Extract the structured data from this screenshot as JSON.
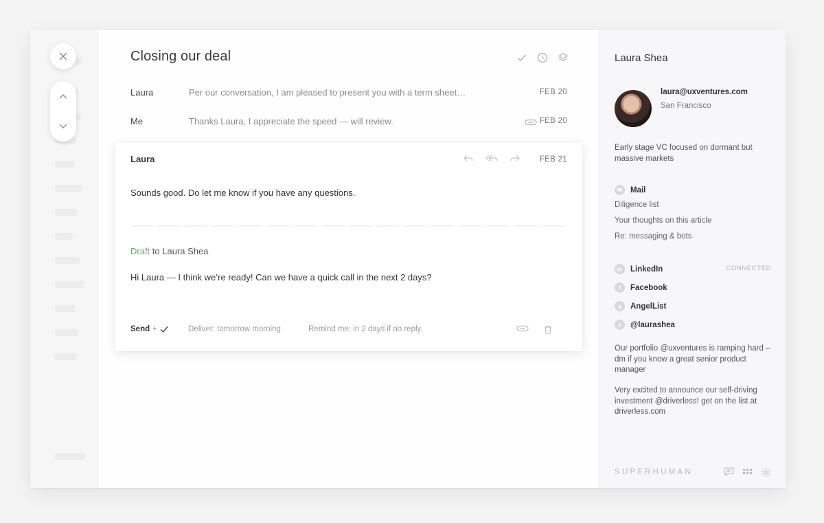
{
  "thread": {
    "subject": "Closing our deal",
    "messages": [
      {
        "from": "Laura",
        "snippet": "Per our conversation, I am pleased to present you with a term sheet…",
        "date": "FEB 20"
      },
      {
        "from": "Me",
        "snippet": "Thanks Laura, I appreciate the speed — will review.",
        "date": "FEB 20"
      }
    ],
    "open_message": {
      "from": "Laura",
      "date": "FEB 21",
      "body": "Sounds good.  Do let me know if you have any questions."
    },
    "draft": {
      "tag": "Draft",
      "to": "to Laura Shea",
      "body": "Hi Laura — I think we’re ready! Can we have a quick call in the next 2 days?",
      "send_label": "Send",
      "send_suffix": "+",
      "deliver": "Deliver: tomorrow morning",
      "remind": "Remind me: in 2 days if no reply"
    }
  },
  "contact": {
    "name": "Laura Shea",
    "email": "laura@uxventures.com",
    "location": "San Francisco",
    "bio": "Early stage VC focused on dormant but massive markets",
    "mail": {
      "heading": "Mail",
      "items": [
        "Diligence list",
        "Your thoughts on this article",
        "Re: messaging & bots"
      ]
    },
    "socials": {
      "linkedin": "LinkedIn",
      "facebook": "Facebook",
      "angellist": "AngelList",
      "twitter": "@laurashea",
      "connected": "CONNECTED"
    },
    "tweets": [
      "Our portfolio @uxventures is ramping hard – dm if you know a great senior product manager",
      "Very excited to announce our self-driving investment @driverless! get on the list at driverless.com"
    ]
  },
  "brand": "SUPERHUMAN",
  "colors": {
    "draft_green": "#6aaa6a",
    "background": "#f4f4f5"
  },
  "icons": [
    "close-icon",
    "chevron-up-icon",
    "chevron-down-icon",
    "check-icon",
    "clock-icon",
    "layers-icon",
    "attachment-icon",
    "reply-icon",
    "reply-all-icon",
    "forward-icon",
    "trash-icon",
    "linkedin-icon",
    "facebook-icon",
    "angellist-icon",
    "twitter-icon",
    "mail-icon",
    "chat-icon",
    "grid-icon",
    "gear-icon"
  ]
}
